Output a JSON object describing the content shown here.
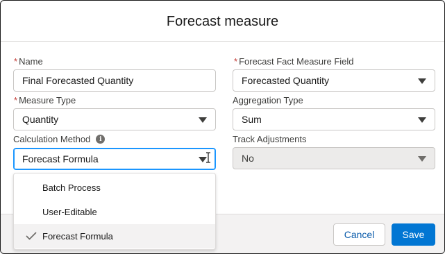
{
  "modal": {
    "title": "Forecast measure"
  },
  "fields": {
    "name": {
      "label": "Name",
      "required_mark": "*",
      "value": "Final Forecasted Quantity"
    },
    "fact_field": {
      "label": "Forecast Fact Measure Field",
      "required_mark": "*",
      "value": "Forecasted Quantity"
    },
    "measure_type": {
      "label": "Measure Type",
      "required_mark": "*",
      "value": "Quantity"
    },
    "aggregation": {
      "label": "Aggregation Type",
      "value": "Sum"
    },
    "calc_method": {
      "label": "Calculation Method",
      "value": "Forecast Formula",
      "info_icon": "info-icon"
    },
    "track_adjustments": {
      "label": "Track Adjustments",
      "value": "No",
      "disabled": true
    }
  },
  "dropdown": {
    "options": [
      {
        "label": "Batch Process",
        "selected": false
      },
      {
        "label": "User-Editable",
        "selected": false
      },
      {
        "label": "Forecast Formula",
        "selected": true
      }
    ]
  },
  "footer": {
    "cancel_label": "Cancel",
    "save_label": "Save"
  },
  "colors": {
    "brand": "#0176d3",
    "required": "#c23934",
    "focus": "#1b96ff"
  }
}
